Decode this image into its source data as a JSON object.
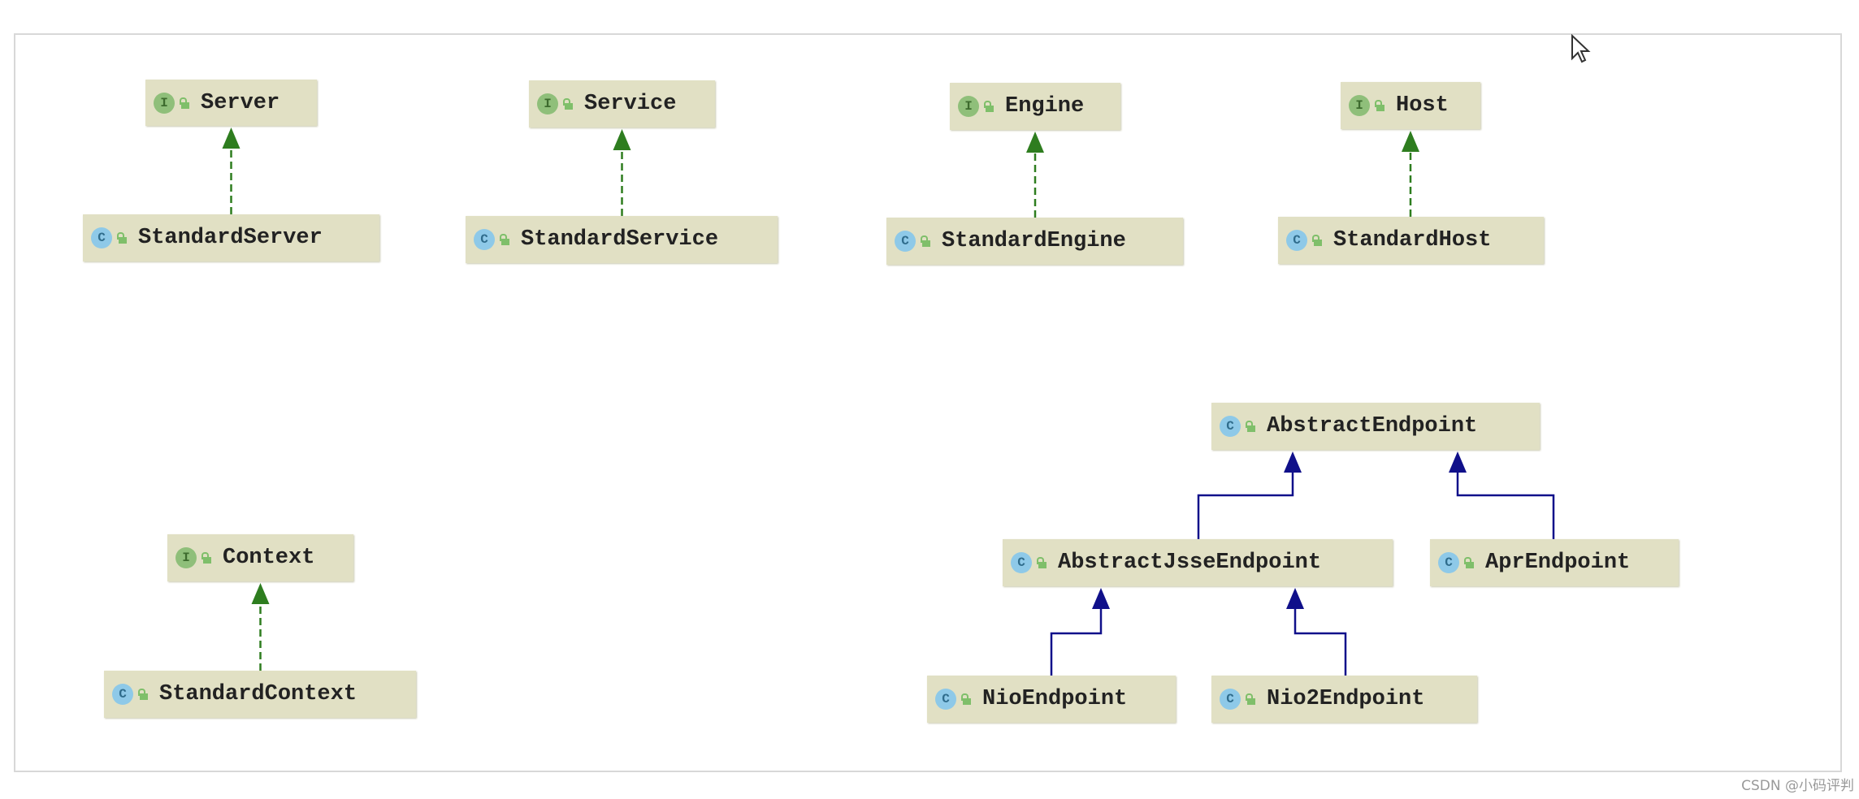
{
  "nodes": [
    {
      "id": "server",
      "name": "Server",
      "kind": "interface"
    },
    {
      "id": "standard-server",
      "name": "StandardServer",
      "kind": "class"
    },
    {
      "id": "service",
      "name": "Service",
      "kind": "interface"
    },
    {
      "id": "standard-service",
      "name": "StandardService",
      "kind": "class"
    },
    {
      "id": "engine",
      "name": "Engine",
      "kind": "interface"
    },
    {
      "id": "standard-engine",
      "name": "StandardEngine",
      "kind": "class"
    },
    {
      "id": "host",
      "name": "Host",
      "kind": "interface"
    },
    {
      "id": "standard-host",
      "name": "StandardHost",
      "kind": "class"
    },
    {
      "id": "context",
      "name": "Context",
      "kind": "interface"
    },
    {
      "id": "standard-context",
      "name": "StandardContext",
      "kind": "class"
    },
    {
      "id": "abstract-endpoint",
      "name": "AbstractEndpoint",
      "kind": "class"
    },
    {
      "id": "abstract-jsse-endpoint",
      "name": "AbstractJsseEndpoint",
      "kind": "class"
    },
    {
      "id": "apr-endpoint",
      "name": "AprEndpoint",
      "kind": "class"
    },
    {
      "id": "nio-endpoint",
      "name": "NioEndpoint",
      "kind": "class"
    },
    {
      "id": "nio2-endpoint",
      "name": "Nio2Endpoint",
      "kind": "class"
    }
  ],
  "badges": {
    "interface": "I",
    "class": "C"
  },
  "edges": [
    {
      "from": "standard-server",
      "to": "server",
      "type": "implements"
    },
    {
      "from": "standard-service",
      "to": "service",
      "type": "implements"
    },
    {
      "from": "standard-engine",
      "to": "engine",
      "type": "implements"
    },
    {
      "from": "standard-host",
      "to": "host",
      "type": "implements"
    },
    {
      "from": "standard-context",
      "to": "context",
      "type": "implements"
    },
    {
      "from": "abstract-jsse-endpoint",
      "to": "abstract-endpoint",
      "type": "extends"
    },
    {
      "from": "apr-endpoint",
      "to": "abstract-endpoint",
      "type": "extends"
    },
    {
      "from": "nio-endpoint",
      "to": "abstract-jsse-endpoint",
      "type": "extends"
    },
    {
      "from": "nio2-endpoint",
      "to": "abstract-jsse-endpoint",
      "type": "extends"
    }
  ],
  "colors": {
    "implements": "#2e7d1f",
    "extends": "#10108a",
    "node_fill": "#e1e0c4"
  },
  "watermark": "CSDN @小码评判"
}
